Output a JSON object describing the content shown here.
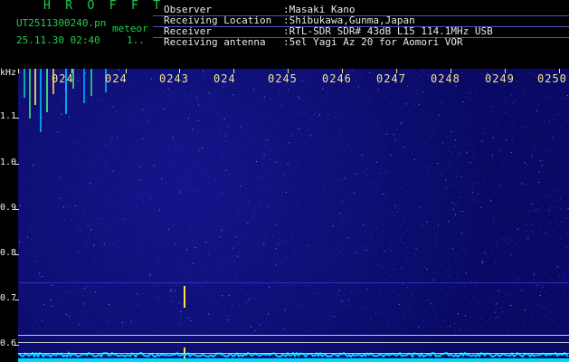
{
  "header": {
    "app_title": "H R O F F T",
    "filename": "UT2511300240.pn",
    "tag": "meteor",
    "datetime": "25.11.30 02:40",
    "counter": "1..",
    "fields": [
      {
        "label": "Observer",
        "value": ":Masaki Kano"
      },
      {
        "label": "Receiving Location",
        "value": ":Shibukawa,Gunma,Japan"
      },
      {
        "label": "Receiver",
        "value": ":RTL-SDR SDR# 43dB L15 114.1MHz USB"
      },
      {
        "label": "Receiving antenna",
        "value": ":5el Yagi Az 20 for Aomori VOR"
      }
    ]
  },
  "spectrogram": {
    "y_unit": "kHz",
    "y_ticks": [
      "1.1",
      "1.0",
      "0.9",
      "0.8",
      "0.7",
      "0.6"
    ],
    "x_ticks": [
      "024",
      "024",
      "0243",
      "024",
      "0245",
      "0246",
      "0247",
      "0248",
      "0249",
      "0250"
    ],
    "colors": {
      "background": "#0a0a66",
      "noise": "#2f2fd0",
      "echo": "#ffe040",
      "trace": "#00d8ff"
    }
  }
}
